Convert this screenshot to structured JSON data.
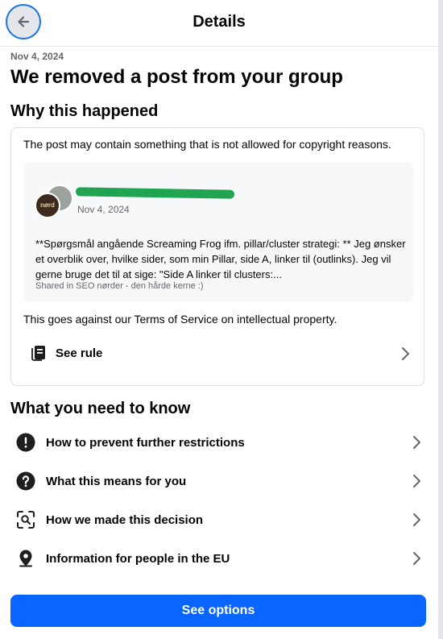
{
  "header": {
    "title": "Details",
    "back_icon": "arrow-left-icon"
  },
  "notice": {
    "date": "Nov 4, 2024",
    "headline": "We removed a post from your group"
  },
  "why": {
    "title": "Why this happened",
    "text": "The post may contain something that is not allowed for copyright reasons.",
    "post": {
      "group_avatar_text": "nørd",
      "date": "Nov 4, 2024",
      "body": "**Spørgsmål angående Screaming Frog ifm. pillar/cluster strategi: ** Jeg ønsker et overblik over, hvilke sider, som min Pillar, side A, linker til (outlinks). Jeg vil gerne bruge det til at sige: \"Side A linker til clusters:...",
      "shared_in": "Shared in SEO nørder - den hårde kerne :)"
    },
    "terms": "This goes against our Terms of Service on intellectual property.",
    "rule_label": "See rule",
    "rule_icon": "book-icon"
  },
  "know": {
    "title": "What you need to know",
    "items": [
      {
        "label": "How to prevent further restrictions",
        "icon": "exclamation-circle-icon"
      },
      {
        "label": "What this means for you",
        "icon": "question-circle-icon"
      },
      {
        "label": "How we made this decision",
        "icon": "magnify-scan-icon"
      },
      {
        "label": "Information for people in the EU",
        "icon": "location-pin-icon"
      }
    ]
  },
  "cta": {
    "label": "See options"
  },
  "colors": {
    "primary": "#0866ff",
    "focus_ring": "#1b74e4",
    "redaction": "#21a452",
    "secondary_text": "#65676b"
  }
}
